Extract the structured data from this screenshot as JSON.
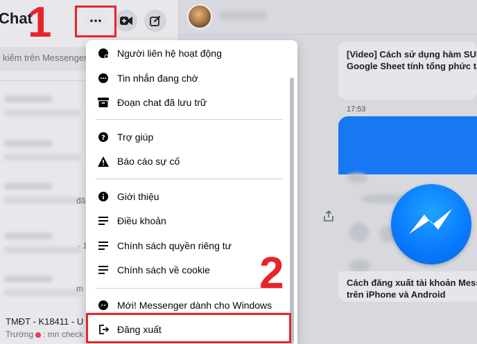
{
  "sidebar": {
    "title": "Chat",
    "search_placeholder": "kiếm trên Messenger",
    "conversation_fragments": [
      "đã",
      "· 1",
      "m"
    ],
    "bottom_conversation": {
      "name": "TMĐT - K18411 - U",
      "sender": "Trường",
      "preview": ": mn check"
    }
  },
  "header_icons": [
    "more-options-icon",
    "video-call-icon",
    "new-message-icon"
  ],
  "menu": {
    "items": [
      {
        "label": "Người liên hệ hoạt động",
        "icon": "active-contacts-icon"
      },
      {
        "label": "Tin nhắn đang chờ",
        "icon": "message-requests-icon"
      },
      {
        "label": "Đoạn chat đã lưu trữ",
        "icon": "archive-icon"
      },
      {
        "label": "Trợ giúp",
        "icon": "help-icon"
      },
      {
        "label": "Báo cáo sự cố",
        "icon": "warning-icon"
      },
      {
        "label": "Giới thiệu",
        "icon": "info-icon"
      },
      {
        "label": "Điều khoản",
        "icon": "document-lines-icon"
      },
      {
        "label": "Chính sách quyền riêng tư",
        "icon": "document-lines-icon"
      },
      {
        "label": "Chính sách về cookie",
        "icon": "document-lines-icon"
      },
      {
        "label": "Mới! Messenger dành cho Windows",
        "icon": "messenger-icon"
      },
      {
        "label": "Đăng xuất",
        "icon": "logout-icon"
      }
    ]
  },
  "chat": {
    "card1": {
      "line1": "[Video] Cách sử dụng hàm SUM",
      "line2": "Google Sheet tính tổng phức tạ"
    },
    "time": "17:53",
    "card2": {
      "line1": "Cách đăng xuất tài khoản Messe",
      "line2": "trên iPhone và Android"
    }
  },
  "annotations": {
    "step1": "1",
    "step2": "2",
    "color": "#e8242a"
  },
  "colors": {
    "accent_blue": "#1877f2",
    "menu_bg": "#ffffff",
    "highlight_red": "#e8242a"
  }
}
